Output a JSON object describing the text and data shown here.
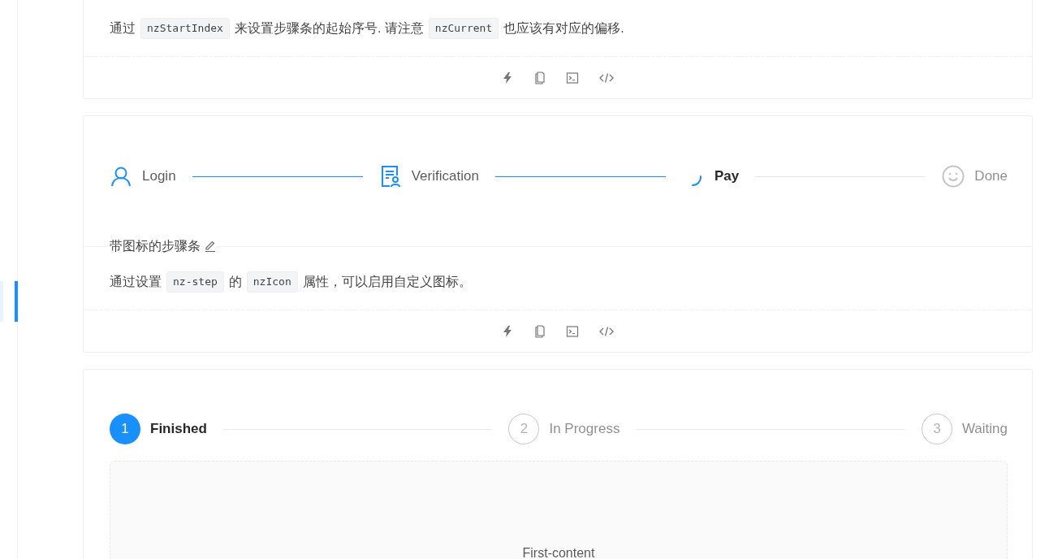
{
  "cards": [
    {
      "description": [
        {
          "kind": "text",
          "text": "通过"
        },
        {
          "kind": "code",
          "text": "nzStartIndex"
        },
        {
          "kind": "text",
          "text": "来设置步骤条的起始序号. 请注意"
        },
        {
          "kind": "code",
          "text": "nzCurrent"
        },
        {
          "kind": "text",
          "text": "也应该有对应的偏移."
        }
      ]
    },
    {
      "steps": [
        {
          "title": "Login",
          "finished": true,
          "current": false
        },
        {
          "title": "Verification",
          "finished": true,
          "current": false
        },
        {
          "title": "Pay",
          "finished": false,
          "current": true
        },
        {
          "title": "Done",
          "finished": false,
          "current": false
        }
      ],
      "title": "带图标的步骤条",
      "description": [
        {
          "kind": "text",
          "text": "通过设置"
        },
        {
          "kind": "code",
          "text": "nz-step"
        },
        {
          "kind": "text",
          "text": "的"
        },
        {
          "kind": "code",
          "text": "nzIcon"
        },
        {
          "kind": "text",
          "text": "属性，可以启用自定义图标。"
        }
      ]
    },
    {
      "numbered_steps": [
        {
          "number": "1",
          "title": "Finished",
          "current": true
        },
        {
          "number": "2",
          "title": "In Progress",
          "current": false
        },
        {
          "number": "3",
          "title": "Waiting",
          "current": false
        }
      ],
      "content": "First-content"
    }
  ]
}
